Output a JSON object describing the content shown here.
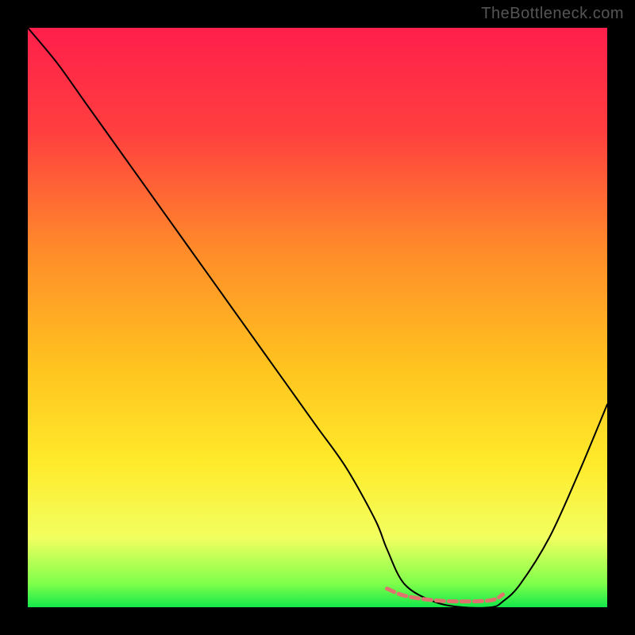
{
  "watermark": "TheBottleneck.com",
  "chart_data": {
    "type": "line",
    "title": "",
    "xlabel": "",
    "ylabel": "",
    "xlim": [
      0,
      100
    ],
    "ylim": [
      0,
      100
    ],
    "gradient_background": {
      "top": "#ff1f4b",
      "upper_mid": "#ff8a2a",
      "mid": "#ffd21f",
      "lower_mid": "#fff95a",
      "bottom": "#14e84a"
    },
    "frame_color": "#000000",
    "series": [
      {
        "name": "bottleneck-curve",
        "color": "#000000",
        "stroke_width": 2,
        "x": [
          0,
          5,
          10,
          15,
          20,
          25,
          30,
          35,
          40,
          45,
          50,
          55,
          60,
          62,
          65,
          70,
          75,
          80,
          82,
          85,
          90,
          95,
          100
        ],
        "y": [
          100,
          94,
          87,
          80,
          73,
          66,
          59,
          52,
          45,
          38,
          31,
          24,
          15,
          10,
          4,
          1,
          0,
          0,
          1,
          4,
          12,
          23,
          35
        ]
      },
      {
        "name": "optimal-band-marker",
        "color": "#e1736e",
        "stroke_width": 5,
        "dash": "10,6",
        "x": [
          62,
          65,
          70,
          75,
          80,
          82
        ],
        "y": [
          3.2,
          2.0,
          1.2,
          1.0,
          1.2,
          2.2
        ]
      }
    ]
  }
}
